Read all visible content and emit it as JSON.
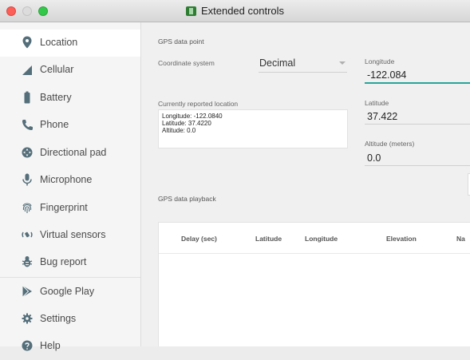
{
  "window": {
    "title": "Extended controls"
  },
  "sidebar": {
    "items": [
      {
        "label": "Location",
        "icon": "location-pin-icon"
      },
      {
        "label": "Cellular",
        "icon": "cellular-signal-icon"
      },
      {
        "label": "Battery",
        "icon": "battery-icon"
      },
      {
        "label": "Phone",
        "icon": "phone-icon"
      },
      {
        "label": "Directional pad",
        "icon": "dpad-icon"
      },
      {
        "label": "Microphone",
        "icon": "microphone-icon"
      },
      {
        "label": "Fingerprint",
        "icon": "fingerprint-icon"
      },
      {
        "label": "Virtual sensors",
        "icon": "rotate-sensor-icon"
      },
      {
        "label": "Bug report",
        "icon": "bug-icon"
      },
      {
        "label": "Google Play",
        "icon": "google-play-icon"
      },
      {
        "label": "Settings",
        "icon": "gear-icon"
      },
      {
        "label": "Help",
        "icon": "help-icon"
      }
    ],
    "selected": "Location"
  },
  "gps": {
    "section_title": "GPS data point",
    "coordinate_system_label": "Coordinate system",
    "coordinate_system_value": "Decimal",
    "longitude_label": "Longitude",
    "longitude_value": "-122.084",
    "latitude_label": "Latitude",
    "latitude_value": "37.422",
    "altitude_label": "Altitude (meters)",
    "altitude_value": "0.0",
    "reported_label": "Currently reported location",
    "reported_lines": [
      "Longitude: -122.0840",
      "Latitude: 37.4220",
      "Altitude: 0.0"
    ]
  },
  "playback": {
    "section_title": "GPS data playback",
    "columns": [
      "Delay (sec)",
      "Latitude",
      "Longitude",
      "Elevation",
      "Na"
    ]
  },
  "colors": {
    "accent": "#26a69a",
    "nav_icon": "#546e7a",
    "close": "#fc5f57",
    "zoom": "#34c84a"
  }
}
